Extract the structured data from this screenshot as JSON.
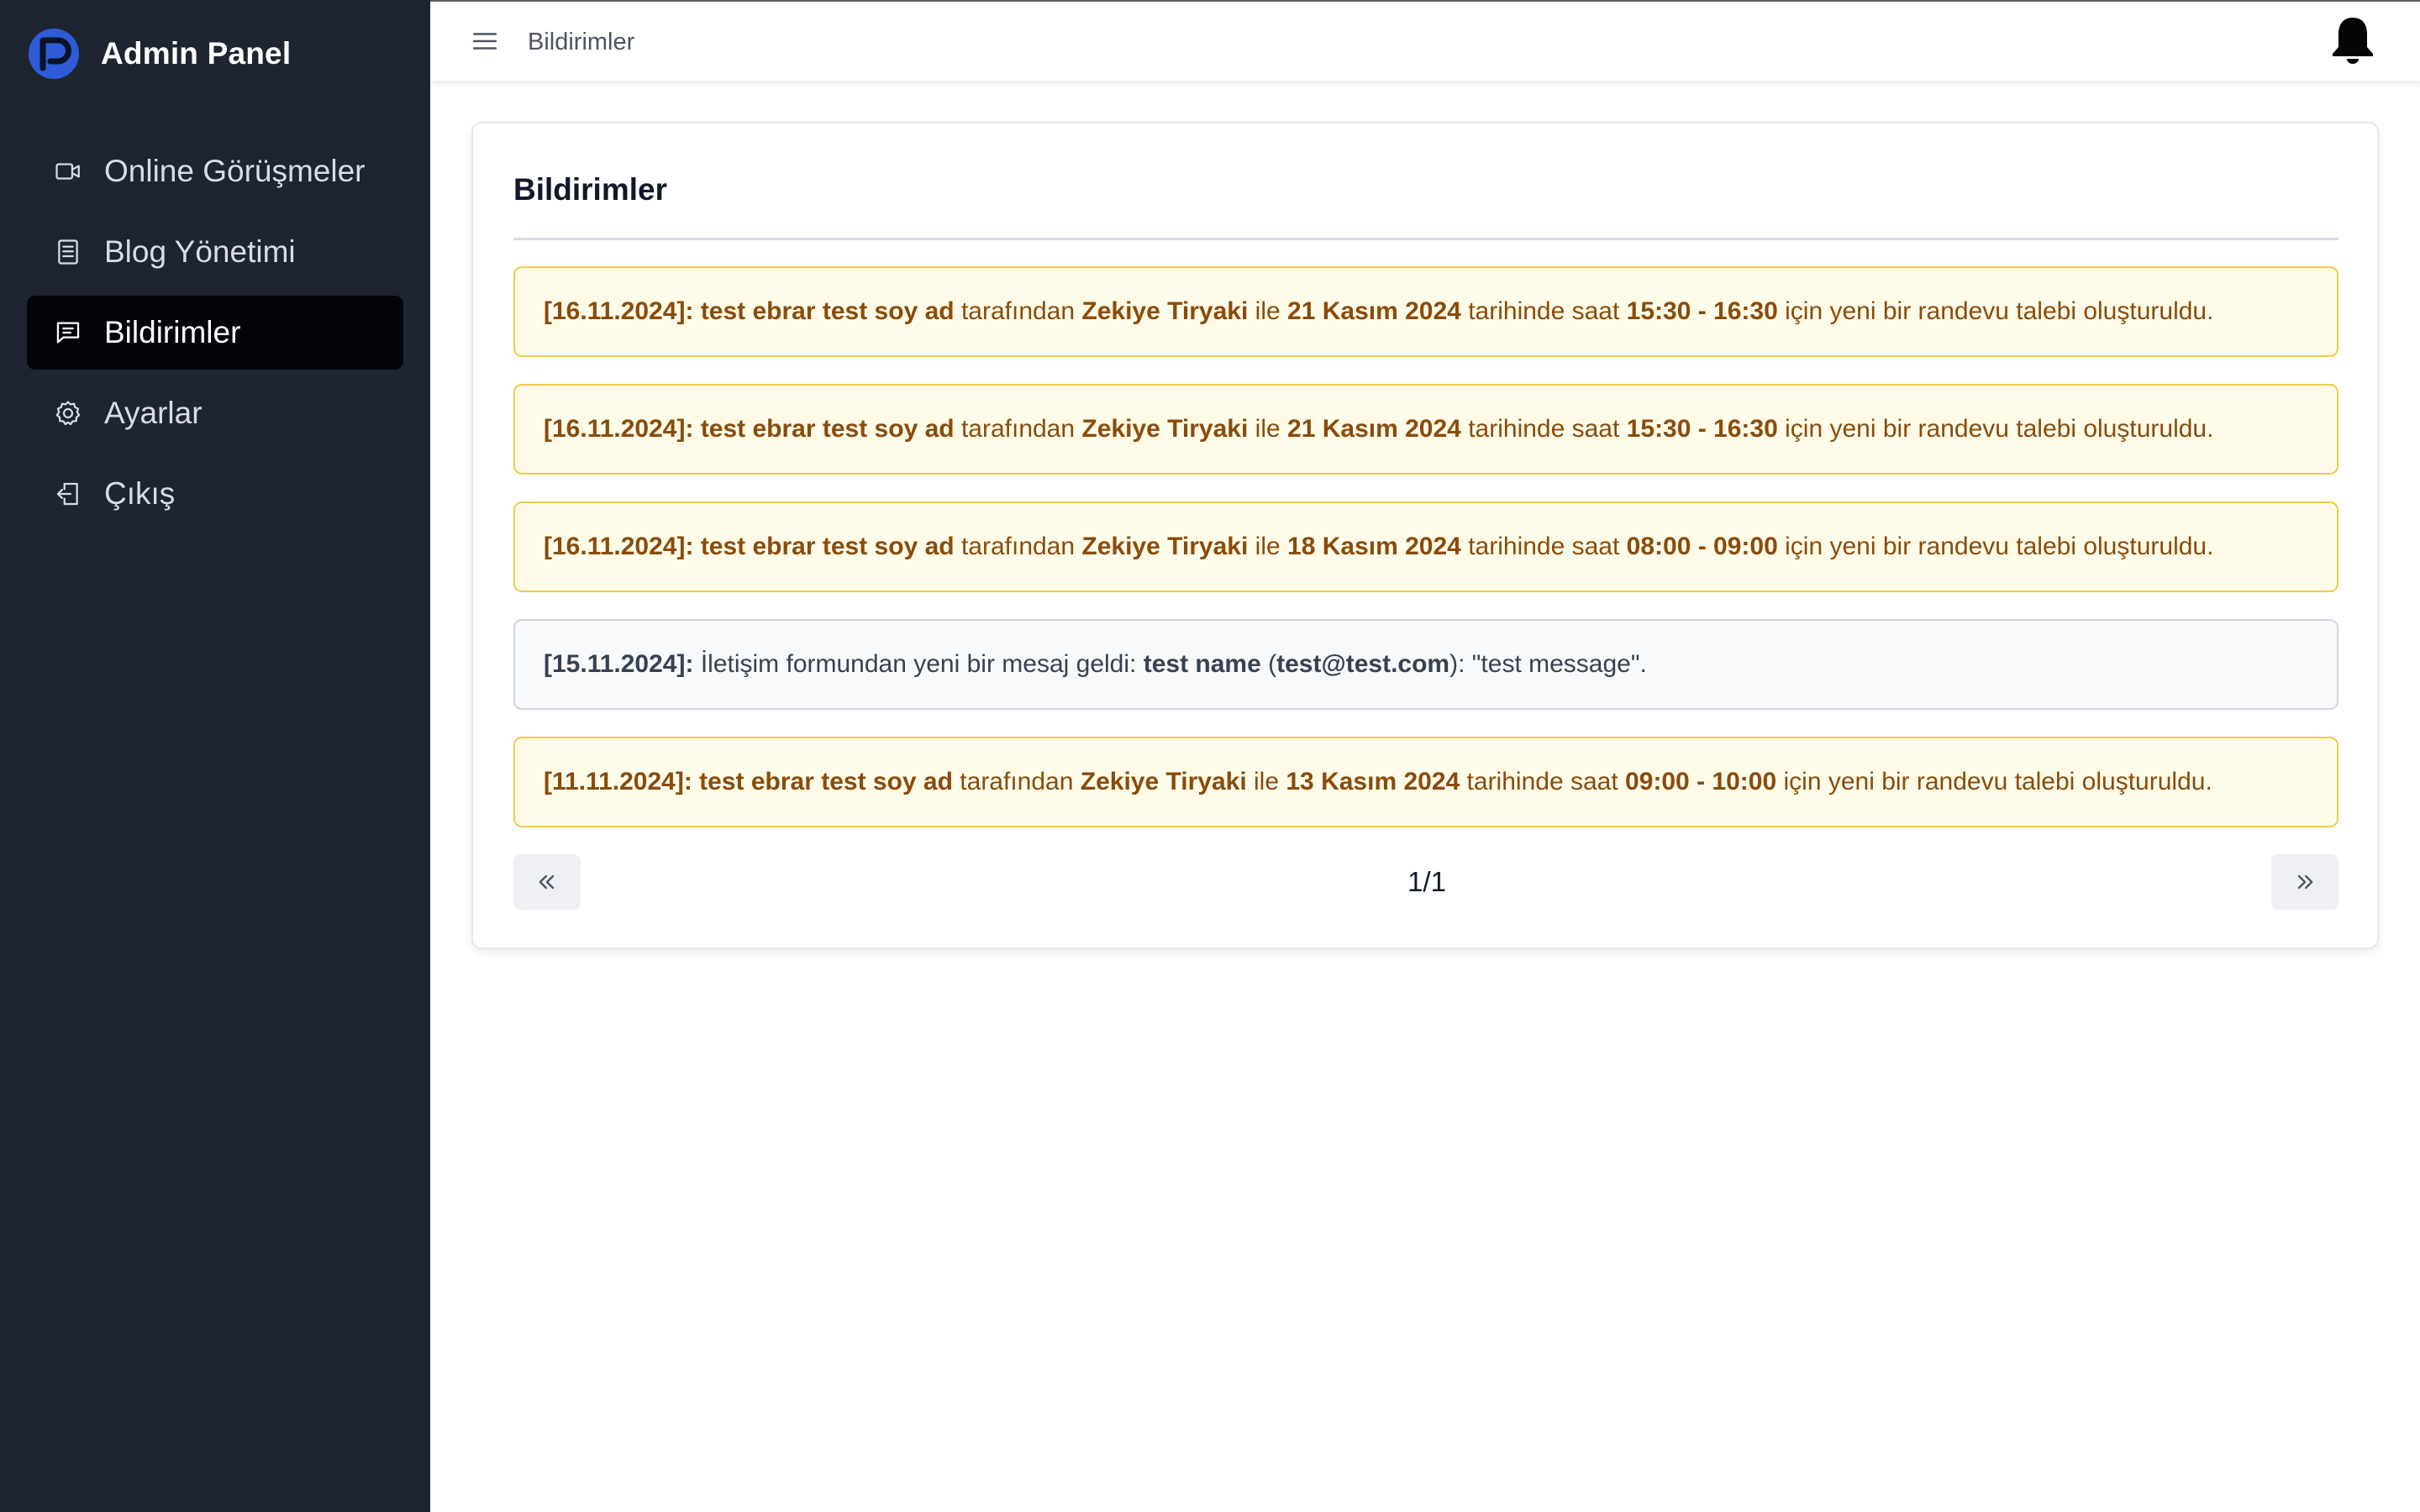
{
  "app": {
    "title": "Admin Panel",
    "brand_color": "#2f5bd9"
  },
  "sidebar": {
    "items": [
      {
        "label": "Online Görüşmeler",
        "icon": "video-camera-icon",
        "active": false
      },
      {
        "label": "Blog Yönetimi",
        "icon": "document-list-icon",
        "active": false
      },
      {
        "label": "Bildirimler",
        "icon": "chat-message-icon",
        "active": true
      },
      {
        "label": "Ayarlar",
        "icon": "gear-icon",
        "active": false
      },
      {
        "label": "Çıkış",
        "icon": "logout-icon",
        "active": false
      }
    ]
  },
  "header": {
    "title": "Bildirimler",
    "menu_icon": "hamburger-menu-icon",
    "bell_icon": "bell-icon"
  },
  "card": {
    "title": "Bildirimler"
  },
  "notifications": [
    {
      "type": "appointment",
      "date": "[16.11.2024]:",
      "user": "test ebrar test soy ad",
      "by_text": "tarafından",
      "doctor": "Zekiye Tiryaki",
      "with_text": "ile",
      "appointment_date": "21 Kasım 2024",
      "date_text": "tarihinde saat",
      "time": "15:30 - 16:30",
      "suffix": "için yeni bir randevu talebi oluşturuldu."
    },
    {
      "type": "appointment",
      "date": "[16.11.2024]:",
      "user": "test ebrar test soy ad",
      "by_text": "tarafından",
      "doctor": "Zekiye Tiryaki",
      "with_text": "ile",
      "appointment_date": "21 Kasım 2024",
      "date_text": "tarihinde saat",
      "time": "15:30 - 16:30",
      "suffix": "için yeni bir randevu talebi oluşturuldu."
    },
    {
      "type": "appointment",
      "date": "[16.11.2024]:",
      "user": "test ebrar test soy ad",
      "by_text": "tarafından",
      "doctor": "Zekiye Tiryaki",
      "with_text": "ile",
      "appointment_date": "18 Kasım 2024",
      "date_text": "tarihinde saat",
      "time": "08:00 - 09:00",
      "suffix": "için yeni bir randevu talebi oluşturuldu."
    },
    {
      "type": "contact",
      "date": "[15.11.2024]:",
      "intro": "İletişim formundan yeni bir mesaj geldi:",
      "name": "test name",
      "open_paren": "(",
      "email": "test@test.com",
      "message_text": "): \"test message\"."
    },
    {
      "type": "appointment",
      "date": "[11.11.2024]:",
      "user": "test ebrar test soy ad",
      "by_text": "tarafından",
      "doctor": "Zekiye Tiryaki",
      "with_text": "ile",
      "appointment_date": "13 Kasım 2024",
      "date_text": "tarihinde saat",
      "time": "09:00 - 10:00",
      "suffix": "için yeni bir randevu talebi oluşturuldu."
    }
  ],
  "pagination": {
    "current": "1/1",
    "prev_icon": "double-chevron-left-icon",
    "next_icon": "double-chevron-right-icon"
  },
  "colors": {
    "sidebar_bg": "#1e2430",
    "active_item_bg": "#03050a",
    "appointment_border": "#f2c94c",
    "appointment_bg": "#fefce8",
    "appointment_text": "#8a4b0c",
    "contact_border": "#d1d5db",
    "contact_bg": "#f8f9fb"
  }
}
